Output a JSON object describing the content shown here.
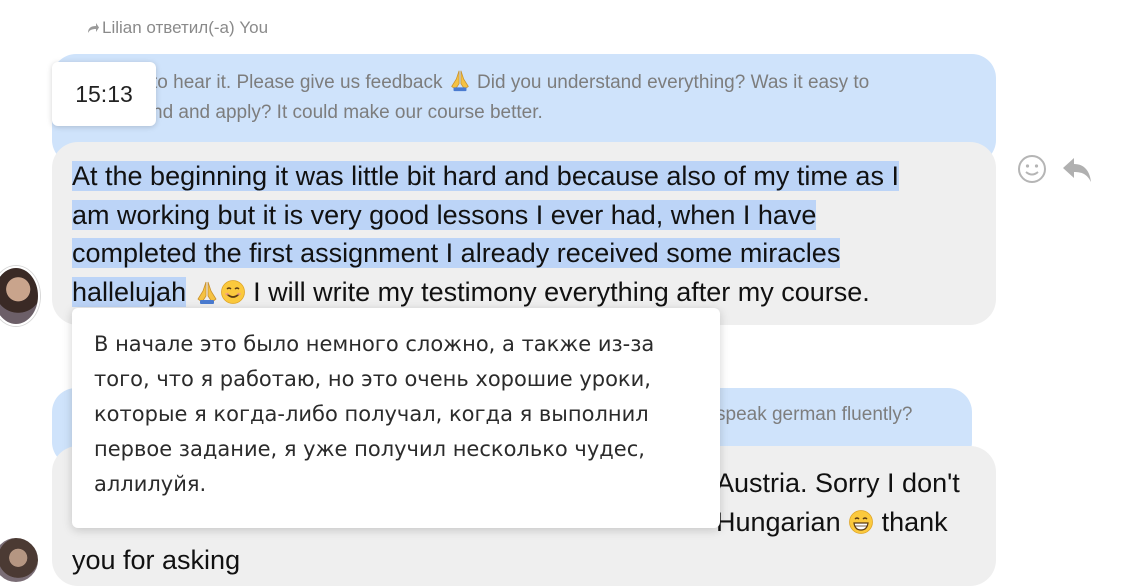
{
  "reply_header": {
    "text": "Lilian ответил(-а) You"
  },
  "quoted_message": {
    "text_line1": "to hear it. Please give us feedback",
    "text_line1_after": "Did you understand everything? Was it easy to",
    "text_line2": "nd and apply? It could make our course better."
  },
  "time_popup": {
    "time": "15:13"
  },
  "main_message": {
    "line1": "At the beginning it was little bit hard and because also of my time as I",
    "line2": "am working but it is very good lessons I ever had, when I have",
    "line3": "completed the first assignment I already received some miracles",
    "line4_highlight": "hallelujah",
    "line4_rest": " I will write my testimony everything after my course."
  },
  "translation_popup": {
    "line1": "В начале это было немного сложно, а также из-за",
    "line2": "того, что я работаю, но это очень хорошие уроки,",
    "line3": "которые я когда-либо получал, когда я выполнил",
    "line4": "первое задание, я уже получил несколько чудес,",
    "line5": "аллилуйя."
  },
  "second_quoted": {
    "visible_text": "speak german fluently?"
  },
  "second_message": {
    "line1_right": "Austria. Sorry I don't",
    "line2_right": "Hungarian",
    "line2_after": " thank",
    "line3": "you for asking"
  },
  "icons": {
    "reply_arrow": "reply-arrow-icon",
    "smiley": "emoji-reaction-icon",
    "reply": "reply-icon",
    "pray_emoji": "praying-hands-emoji",
    "smile_emoji": "smiling-face-emoji",
    "grin_emoji": "grinning-face-emoji"
  },
  "colors": {
    "outgoing_bubble": "#cfe3fb",
    "incoming_bubble": "#efefef",
    "selection_highlight": "#bcd4f7"
  }
}
